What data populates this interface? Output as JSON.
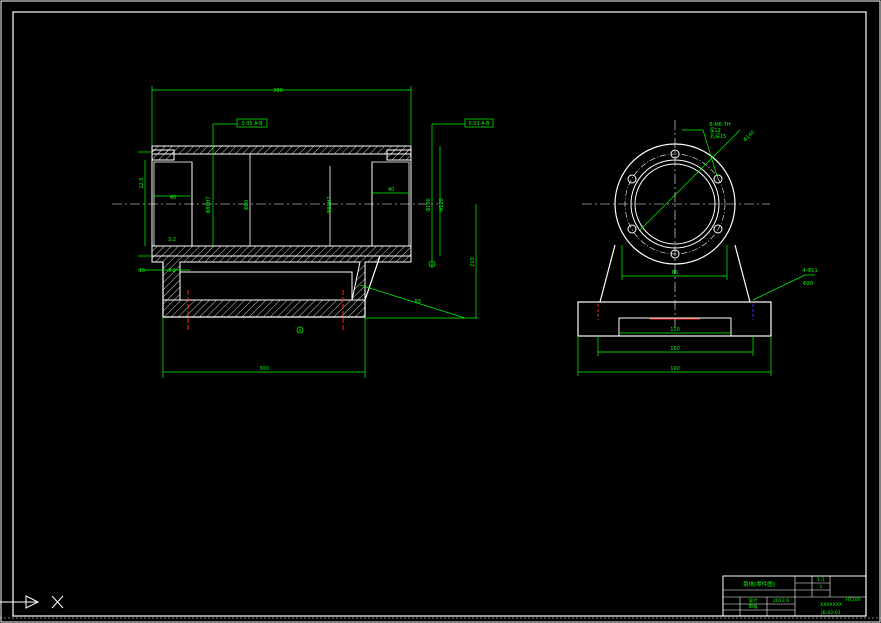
{
  "drawing": {
    "colors": {
      "background": "#000000",
      "outline": "#ffffff",
      "dimension": "#00ff00",
      "hatch": "#ffffff",
      "centerline": "#ffffff",
      "cut_mark": "#ff2020",
      "hidden": "#3030ff"
    },
    "front_view": {
      "dim_top": "380",
      "dim_bottom": "300",
      "gdt_left": "0.05 A-B",
      "gdt_right": "0.03 A-B",
      "dim_inner_left": "40",
      "dim_inner_right": "40",
      "dim_bore_left": "Φ80H7",
      "dim_bore_mid": "Φ80",
      "dim_bore_right": "Φ80H7",
      "dim_outer_right_a": "Φ100",
      "dim_outer_right_b": "Φ120",
      "dim_height": "210",
      "dim_left_a": "12.5",
      "dim_left_b": "3.2",
      "dim_left_c": "15",
      "dim_left_d": "3.2",
      "leader_note": "R5",
      "datum_a": "A",
      "datum_b": "B"
    },
    "side_view": {
      "hole_note_1": "6-M6-7H",
      "hole_note_2": "深12",
      "hole_note_3": "孔深15",
      "pcd_label": "Φ140",
      "dim_span_upper": "80",
      "dim_slot": "110",
      "dim_base_inner": "160",
      "dim_base_total": "190",
      "base_note": "4-Φ11",
      "base_note_2": "Φ20"
    },
    "title_block": {
      "title": "泵体[零件图]",
      "scale_label": "1:1",
      "qty": "1",
      "material": "HT200",
      "drawn_by": "设计",
      "date": "2013.6",
      "check": "审核",
      "school": "XXXXXXX",
      "drawing_no": "JB-02-01"
    },
    "ucs": {
      "x_axis": "X"
    }
  }
}
